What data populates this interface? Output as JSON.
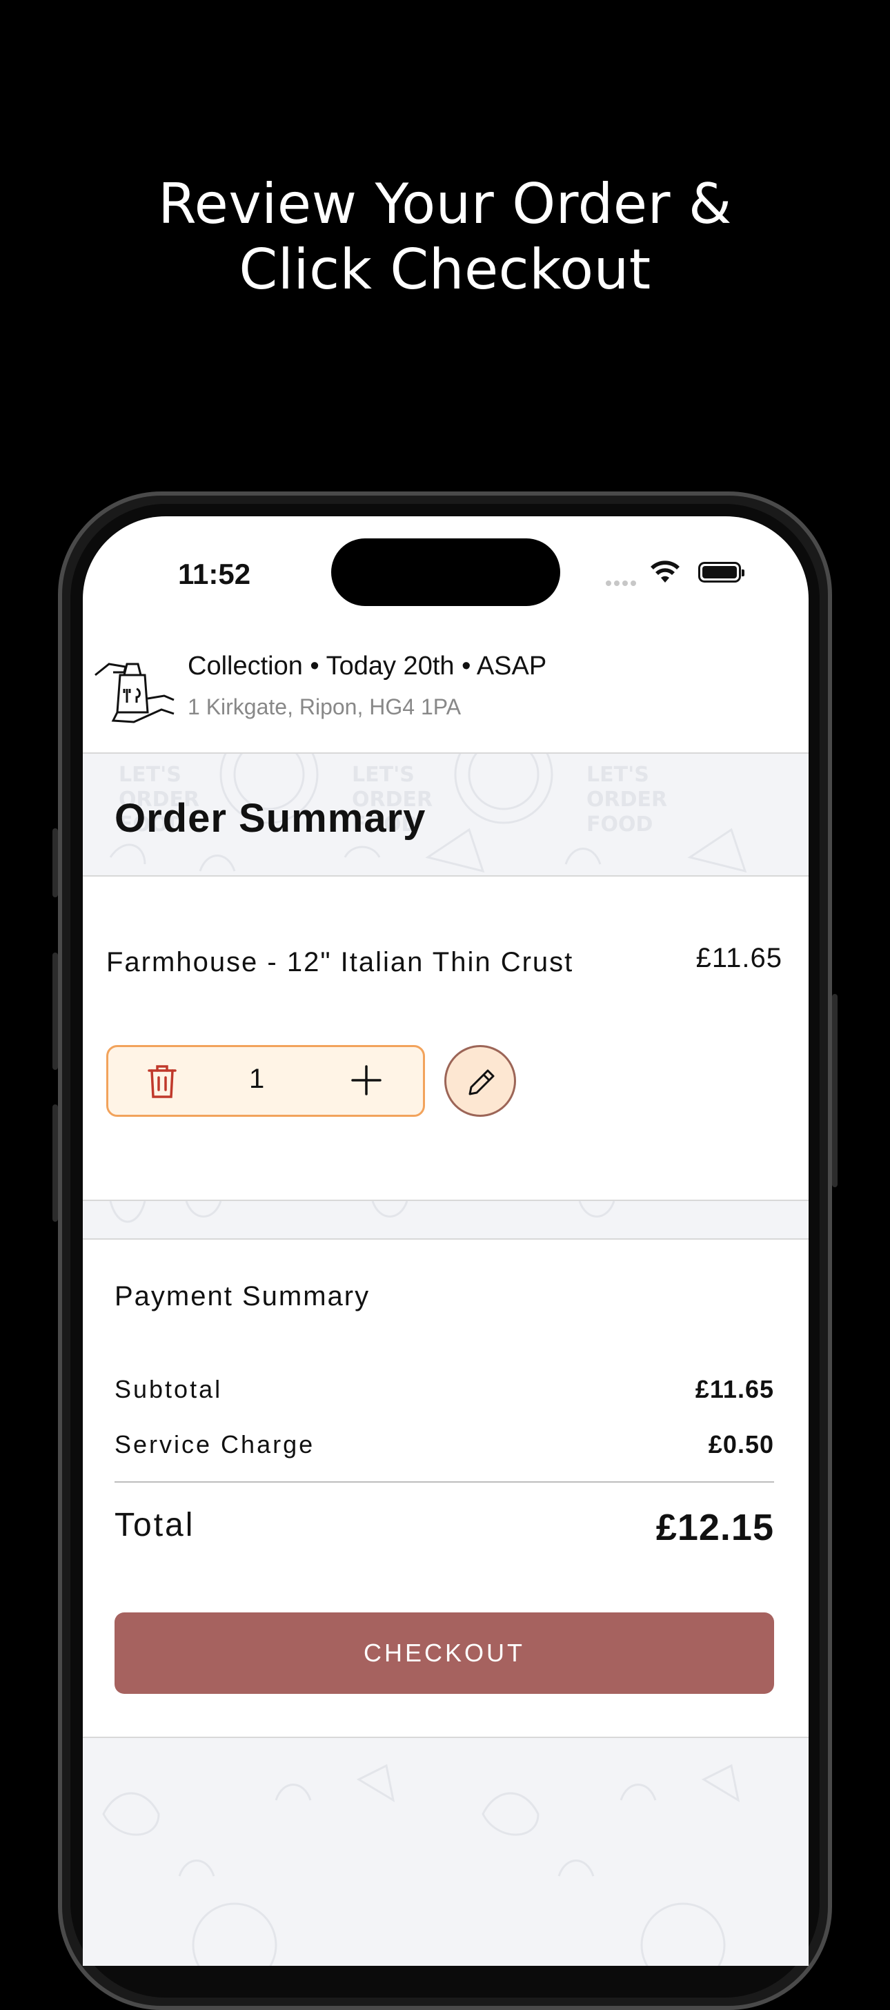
{
  "headline": {
    "line1": "Review Your Order &",
    "line2": "Click Checkout"
  },
  "status_bar": {
    "time": "11:52"
  },
  "header": {
    "summary": "Collection • Today 20th • ASAP",
    "address": "1 Kirkgate, Ripon, HG4 1PA"
  },
  "order_summary": {
    "title": "Order Summary"
  },
  "item": {
    "name": "Farmhouse - 12\" Italian Thin Crust",
    "price": "£11.65",
    "quantity": "1"
  },
  "payment": {
    "title": "Payment Summary",
    "subtotal_label": "Subtotal",
    "subtotal_value": "£11.65",
    "service_label": "Service Charge",
    "service_value": "£0.50",
    "total_label": "Total",
    "total_value": "£12.15",
    "checkout_label": "CHECKOUT"
  },
  "colors": {
    "accent": "#a6625f",
    "qty_bg": "#fff4e6",
    "qty_border": "#f2a35c",
    "trash": "#c0392b",
    "pattern_bg": "#f3f4f7"
  },
  "icons": [
    "collection-bag-icon",
    "trash-icon",
    "plus-icon",
    "pencil-icon",
    "wifi-icon",
    "battery-icon"
  ]
}
